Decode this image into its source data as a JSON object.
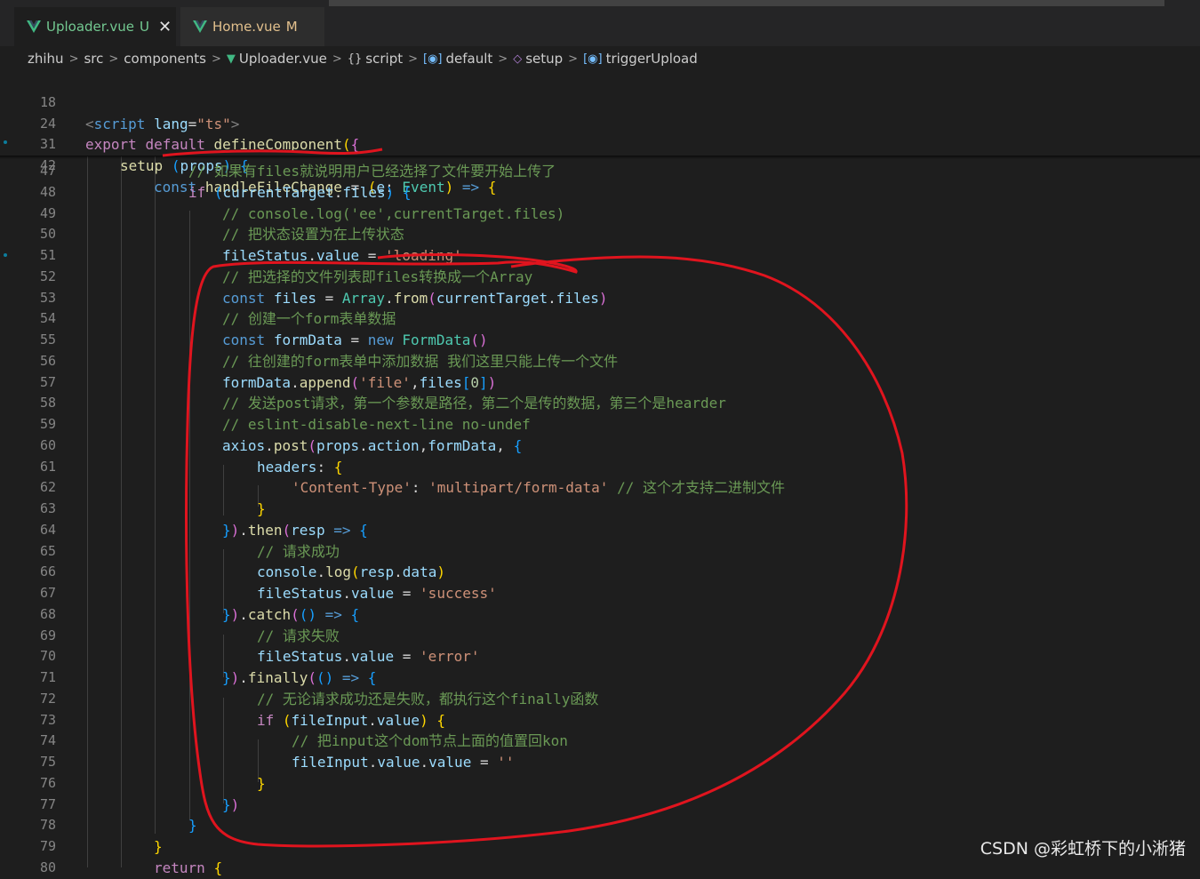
{
  "tabs": [
    {
      "name": "Uploader.vue",
      "status": "U",
      "close": "✕"
    },
    {
      "name": "Home.vue",
      "status": "M"
    }
  ],
  "breadcrumb": [
    "zhihu",
    "src",
    "components",
    "Uploader.vue",
    "script",
    "default",
    "setup",
    "triggerUpload"
  ],
  "sticky_lines": [
    {
      "n": "18"
    },
    {
      "n": "24"
    },
    {
      "n": "31"
    },
    {
      "n": "42"
    }
  ],
  "lines": [
    {
      "n": "47"
    },
    {
      "n": "48"
    },
    {
      "n": "49"
    },
    {
      "n": "50"
    },
    {
      "n": "51"
    },
    {
      "n": "52"
    },
    {
      "n": "53"
    },
    {
      "n": "54"
    },
    {
      "n": "55"
    },
    {
      "n": "56"
    },
    {
      "n": "57"
    },
    {
      "n": "58"
    },
    {
      "n": "59"
    },
    {
      "n": "60"
    },
    {
      "n": "61"
    },
    {
      "n": "62"
    },
    {
      "n": "63"
    },
    {
      "n": "64"
    },
    {
      "n": "65"
    },
    {
      "n": "66"
    },
    {
      "n": "67"
    },
    {
      "n": "68"
    },
    {
      "n": "69"
    },
    {
      "n": "70"
    },
    {
      "n": "71"
    },
    {
      "n": "72"
    },
    {
      "n": "73"
    },
    {
      "n": "74"
    },
    {
      "n": "75"
    },
    {
      "n": "76"
    },
    {
      "n": "77"
    },
    {
      "n": "78"
    },
    {
      "n": "79"
    },
    {
      "n": "80"
    }
  ],
  "code": {
    "l18": {
      "open": "<",
      "tag": "script",
      "attr": "lang",
      "eq": "=",
      "val": "\"ts\"",
      "close": ">"
    },
    "l24": {
      "kw1": "export",
      "kw2": "default",
      "fn": "defineComponent",
      "p": "(",
      "b": "{"
    },
    "l31": {
      "fn": "setup",
      "p1": "(",
      "arg": "props",
      "p2": ")",
      "b": "{"
    },
    "l42": {
      "kw": "const",
      "fn": "handleFileChange",
      "eq": "=",
      "p1": "(",
      "arg": "e",
      "colon": ":",
      "ty": "Event",
      "p2": ")",
      "arrow": "=>",
      "b": "{"
    },
    "l47": "// 如果有files就说明用户已经选择了文件要开始上传了",
    "l48": {
      "kw": "if",
      "p1": "(",
      "obj": "currentTarget",
      "dot": ".",
      "prop": "files",
      "p2": ")",
      "b": "{"
    },
    "l49": "// console.log('ee',currentTarget.files)",
    "l50": "// 把状态设置为在上传状态",
    "l51": {
      "obj": "fileStatus",
      "dot": ".",
      "prop": "value",
      "eq": " = ",
      "str": "'loading'"
    },
    "l52": "// 把选择的文件列表即files转换成一个Array",
    "l53": {
      "kw": "const",
      "v": "files",
      "eq": " = ",
      "ty": "Array",
      "dot": ".",
      "fn": "from",
      "p1": "(",
      "obj": "currentTarget",
      "dot2": ".",
      "prop": "files",
      "p2": ")"
    },
    "l54": "// 创建一个form表单数据",
    "l55": {
      "kw": "const",
      "v": "formData",
      "eq": " = ",
      "kw2": "new",
      "ty": "FormData",
      "p": "()"
    },
    "l56": "// 往创建的form表单中添加数据 我们这里只能上传一个文件",
    "l57": {
      "obj": "formData",
      "dot": ".",
      "fn": "append",
      "p1": "(",
      "str": "'file'",
      "comma": ",",
      "v": "files",
      "br1": "[",
      "num": "0",
      "br2": "]",
      "p2": ")"
    },
    "l58": "// 发送post请求，第一个参数是路径，第二个是传的数据，第三个是hearder",
    "l59": "// eslint-disable-next-line no-undef",
    "l60": {
      "obj": "axios",
      "dot": ".",
      "fn": "post",
      "p1": "(",
      "a1": "props",
      "dot2": ".",
      "a1p": "action",
      "comma": ",",
      "a2": "formData",
      "comma2": ", ",
      "b": "{"
    },
    "l61": {
      "prop": "headers",
      "colon": ": ",
      "b": "{"
    },
    "l62": {
      "key": "'Content-Type'",
      "colon": ": ",
      "val": "'multipart/form-data'",
      "cm": "// 这个才支持二进制文件"
    },
    "l63": "}",
    "l64": {
      "b": "}",
      "p": ")",
      "dot": ".",
      "fn": "then",
      "p1": "(",
      "arg": "resp",
      "arrow": " => ",
      "b2": "{"
    },
    "l65": "// 请求成功",
    "l66": {
      "obj": "console",
      "dot": ".",
      "fn": "log",
      "p1": "(",
      "a": "resp",
      "dot2": ".",
      "ap": "data",
      "p2": ")"
    },
    "l67": {
      "obj": "fileStatus",
      "dot": ".",
      "prop": "value",
      "eq": " = ",
      "str": "'success'"
    },
    "l68": {
      "b": "}",
      "p": ")",
      "dot": ".",
      "fn": "catch",
      "p1": "(",
      "pp": "()",
      "arrow": " => ",
      "b2": "{"
    },
    "l69": "// 请求失败",
    "l70": {
      "obj": "fileStatus",
      "dot": ".",
      "prop": "value",
      "eq": " = ",
      "str": "'error'"
    },
    "l71": {
      "b": "}",
      "p": ")",
      "dot": ".",
      "fn": "finally",
      "p1": "(",
      "pp": "()",
      "arrow": " => ",
      "b2": "{"
    },
    "l72": "// 无论请求成功还是失败，都执行这个finally函数",
    "l73": {
      "kw": "if",
      "p1": "(",
      "obj": "fileInput",
      "dot": ".",
      "prop": "value",
      "p2": ")",
      "b": "{"
    },
    "l74": "// 把input这个dom节点上面的值置回kon",
    "l75": {
      "obj": "fileInput",
      "dot": ".",
      "prop": "value",
      "dot2": ".",
      "prop2": "value",
      "eq": " = ",
      "str": "''"
    },
    "l76": "}",
    "l77": {
      "b": "}",
      "p": ")"
    },
    "l78": "}",
    "l79": "}",
    "l80": {
      "kw": "return",
      "b": "{"
    }
  },
  "watermark": "CSDN @彩虹桥下的小淅猪",
  "colors": {
    "annotation": "#e0141e",
    "background": "#1e1e1e"
  }
}
